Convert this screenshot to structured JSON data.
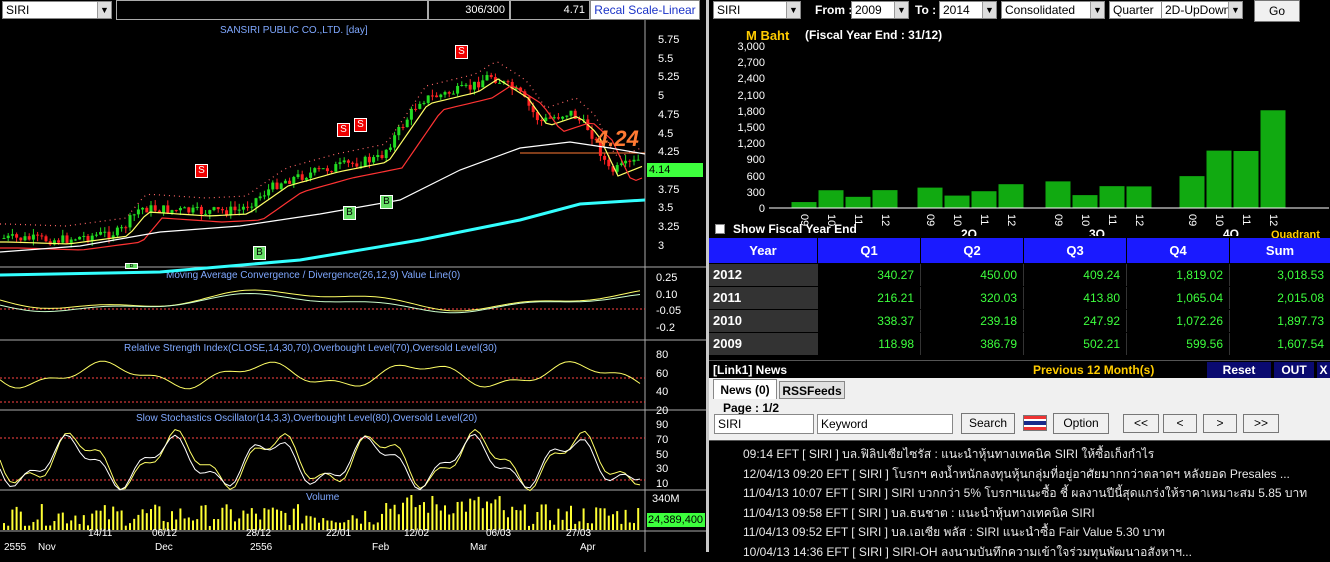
{
  "chart_window": {
    "symbol": "SIRI",
    "bars_count": "306/300",
    "last_price_box": "4.71",
    "recal_label": "Recal Scale-Linear",
    "main_title": "SANSIRI PUBLIC CO.,LTD. [day]",
    "price_axis": [
      "5.75",
      "5.5",
      "5.25",
      "5",
      "4.75",
      "4.5",
      "4.25",
      "4",
      "3.75",
      "3.5",
      "3.25",
      "3"
    ],
    "current_price_tag": "4.14",
    "big_price_label": "4.24",
    "signals": [
      "S",
      "S",
      "S",
      "S",
      "B",
      "B",
      "B",
      "B"
    ],
    "macd": {
      "title": "Moving Average Convergence / Divergence(26,12,9) Value Line(0)",
      "axis": [
        "0.25",
        "0.10",
        "-0.05",
        "-0.2"
      ]
    },
    "rsi": {
      "title": "Relative Strength Index(CLOSE,14,30,70),Overbought Level(70),Oversold Level(30)",
      "axis": [
        "80",
        "60",
        "40",
        "20"
      ]
    },
    "stoch": {
      "title": "Slow Stochastics Oscillator(14,3,3),Overbought Level(80),Oversold Level(20)",
      "axis": [
        "90",
        "70",
        "50",
        "30",
        "10"
      ]
    },
    "volume": {
      "title": "Volume",
      "axis": [
        "340M"
      ],
      "current": "24,389,400"
    },
    "date_axis_top": [
      "14/11",
      "06/12",
      "28/12",
      "22/01",
      "12/02",
      "06/03",
      "27/03"
    ],
    "date_axis_bottom": [
      "2555",
      "Nov",
      "Dec",
      "2556",
      "Feb",
      "Mar",
      "Apr"
    ],
    "colors": {
      "up": "#22dd22",
      "down": "#ff2222",
      "ma_fast": "#ffff66",
      "ma_mid": "#ff3333",
      "ma_slow": "#ffffff",
      "ma_long": "#33ffff"
    }
  },
  "financials": {
    "symbol": "SIRI",
    "from_label": "From :",
    "from_value": "2009",
    "to_label": "To :",
    "to_value": "2014",
    "mode_value": "Consolidated",
    "period_value": "Quarter",
    "view_value": "2D-UpDown",
    "go_label": "Go",
    "unit_label": "M Baht",
    "fiscal_label": "(Fiscal Year End : 31/12)",
    "y_axis": [
      "3,000",
      "2,700",
      "2,400",
      "2,100",
      "1,800",
      "1,500",
      "1,200",
      "900",
      "600",
      "300",
      "0"
    ],
    "show_fiscal_label": "Show Fiscal Year End",
    "quadrant_label": "Quadrant",
    "group_labels": [
      "",
      "2Q",
      "3Q",
      "4Q"
    ],
    "bar_year_labels": [
      "09",
      "10",
      "11",
      "12"
    ],
    "table_headers": [
      "Year",
      "Q1",
      "Q2",
      "Q3",
      "Q4",
      "Sum"
    ],
    "rows": [
      {
        "year": "2012",
        "cells": [
          "340.27",
          "450.00",
          "409.24",
          "1,819.02",
          "3,018.53"
        ]
      },
      {
        "year": "2011",
        "cells": [
          "216.21",
          "320.03",
          "413.80",
          "1,065.04",
          "2,015.08"
        ]
      },
      {
        "year": "2010",
        "cells": [
          "338.37",
          "239.18",
          "247.92",
          "1,072.26",
          "1,897.73"
        ]
      },
      {
        "year": "2009",
        "cells": [
          "118.98",
          "386.79",
          "502.21",
          "599.56",
          "1,607.54"
        ]
      }
    ]
  },
  "chart_data": {
    "type": "bar",
    "title": "",
    "ylabel": "M Baht",
    "ylim": [
      0,
      3000
    ],
    "categories": [
      "09",
      "10",
      "11",
      "12"
    ],
    "series": [
      {
        "name": "Q1",
        "values": [
          118.98,
          338.37,
          216.21,
          340.27
        ]
      },
      {
        "name": "Q2",
        "values": [
          386.79,
          239.18,
          320.03,
          450.0
        ]
      },
      {
        "name": "Q3",
        "values": [
          502.21,
          247.92,
          413.8,
          409.24
        ]
      },
      {
        "name": "Q4",
        "values": [
          599.56,
          1072.26,
          1065.04,
          1819.02
        ]
      }
    ]
  },
  "news": {
    "header": "[Link1] News",
    "period_label": "Previous 12 Month(s)",
    "reset_label": "Reset",
    "out_label": "OUT",
    "close_label": "X",
    "tab_news": "News (0)",
    "tab_rss": "RSSFeeds",
    "page_label": "Page : 1/2",
    "symbol_value": "SIRI",
    "keyword_value": "Keyword",
    "search_label": "Search",
    "option_label": "Option",
    "nav_first": "<<",
    "nav_prev": "<",
    "nav_next": ">",
    "nav_last": ">>",
    "items": [
      "09:14  EFT  [ SIRI ]  บล.ฟิลิปเซียไซรัส : แนะนำหุ้นทางเทคนิค SIRI ให้ซื้อเก็งกำไร",
      "12/04/13 09:20  EFT  [ SIRI ]  โบรกฯ คงน้ำหนักลงทุนหุ้นกลุ่มที่อยู่อาศัยมากกว่าตลาดฯ หลังยอด Presales ...",
      "11/04/13 10:07  EFT  [ SIRI ]  SIRI บวกกว่า 5% โบรกฯแนะซื้อ ชี้ ผลงานปีนี้สุดแกร่งให้ราคาเหมาะสม 5.85 บาท",
      "11/04/13 09:58  EFT  [ SIRI ]  บล.ธนชาต : แนะนำหุ้นทางเทคนิค SIRI",
      "11/04/13 09:52  EFT  [ SIRI ]  บล.เอเซีย พลัส : SIRI แนะนำซื้อ Fair Value 5.30 บาท",
      "10/04/13 14:36  EFT  [ SIRI ]  SIRI-OH ลงนามบันทึกความเข้าใจร่วมทุนพัฒนาอสังหาฯ..."
    ]
  }
}
